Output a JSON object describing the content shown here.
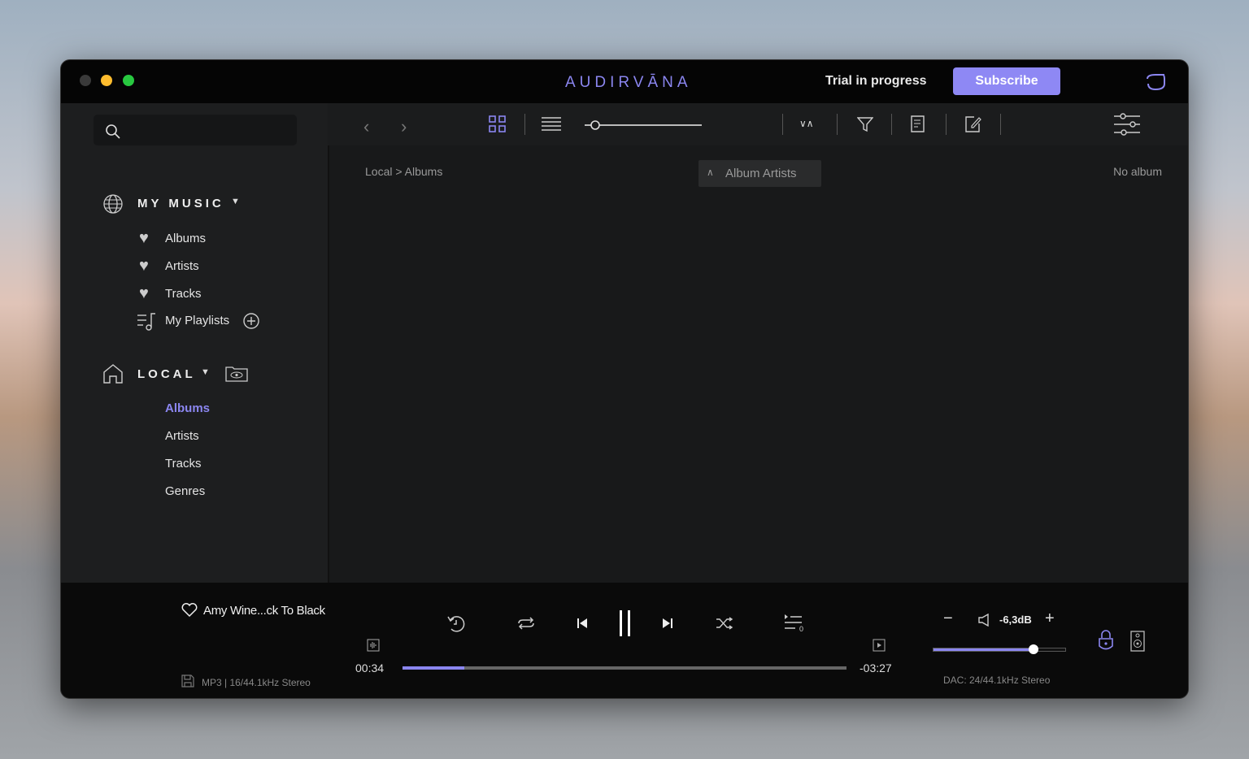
{
  "titlebar": {
    "logo": "AUDIRVĀNA",
    "trial": "Trial in progress",
    "subscribe": "Subscribe"
  },
  "sidebar": {
    "search_placeholder": "",
    "my_music": {
      "label": "MY MUSIC",
      "items": [
        "Albums",
        "Artists",
        "Tracks",
        "My Playlists"
      ]
    },
    "local": {
      "label": "LOCAL",
      "items": [
        "Albums",
        "Artists",
        "Tracks",
        "Genres"
      ],
      "active": "Albums"
    }
  },
  "content": {
    "breadcrumb": "Local > Albums",
    "sort_label": "Album Artists",
    "count": "No album"
  },
  "player": {
    "track": "Amy Wine...ck To Black",
    "format": "MP3 | 16/44.1kHz Stereo",
    "elapsed": "00:34",
    "remaining": "-03:27",
    "progress": 0.14,
    "volume_db": "-6,3dB",
    "volume": 0.76,
    "dac": "DAC: 24/44.1kHz Stereo",
    "queue_count": "0"
  },
  "colors": {
    "accent": "#8b86f0"
  }
}
